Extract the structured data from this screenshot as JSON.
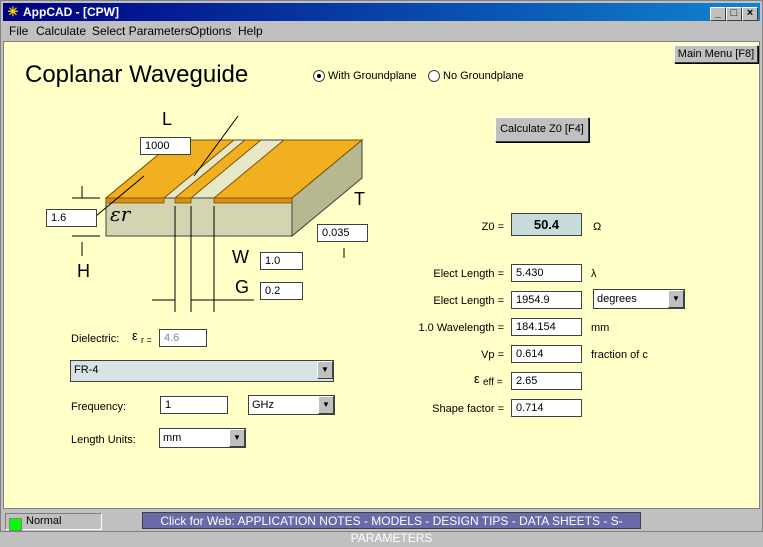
{
  "window": {
    "title": "AppCAD - [CPW]",
    "minimize": "_",
    "maximize": "□",
    "close": "×"
  },
  "menu": [
    {
      "label": "File"
    },
    {
      "label": "Calculate"
    },
    {
      "label": "Select Parameters"
    },
    {
      "label": "Options"
    },
    {
      "label": "Help"
    }
  ],
  "main_menu_button": "Main Menu [F8]",
  "page_title": "Coplanar Waveguide",
  "groundplane": {
    "with_label": "With Groundplane",
    "without_label": "No Groundplane",
    "selected": "with"
  },
  "calc_button": "Calculate Z0  [F4]",
  "diagram": {
    "L_label": "L",
    "L_value": "1000",
    "H_label": "H",
    "H_value": "1.6",
    "T_label": "T",
    "T_value": "0.035",
    "W_label": "W",
    "W_value": "1.0",
    "G_label": "G",
    "G_value": "0.2",
    "er_label": "εr"
  },
  "dielectric": {
    "label": "Dielectric:",
    "er_symbol": "ε",
    "er_suffix": "r =",
    "er_value": "4.6",
    "material": "FR-4"
  },
  "frequency": {
    "label": "Frequency:",
    "value": "1",
    "unit": "GHz"
  },
  "length_units": {
    "label": "Length Units:",
    "value": "mm"
  },
  "results": {
    "z0_label": "Z0 =",
    "z0_value": "50.4",
    "z0_unit": "Ω",
    "elect1_label": "Elect Length =",
    "elect1_value": "5.430",
    "elect1_unit": "λ",
    "elect2_label": "Elect Length =",
    "elect2_value": "1954.9",
    "elect2_unit": "degrees",
    "wave_label": "1.0 Wavelength =",
    "wave_value": "184.154",
    "wave_unit": "mm",
    "vp_label": "Vp =",
    "vp_value": "0.614",
    "vp_unit": "fraction of c",
    "eeff_symbol": "ε",
    "eeff_suffix": "eff =",
    "eeff_value": "2.65",
    "shape_label": "Shape factor =",
    "shape_value": "0.714"
  },
  "status": {
    "mode": "Normal",
    "web_link": "Click for Web: APPLICATION NOTES - MODELS - DESIGN TIPS - DATA SHEETS - S-PARAMETERS"
  },
  "colors": {
    "client_bg": "#ffffc8",
    "metal": "#f0b020",
    "substrate": "#d8d8b8",
    "title_blue": "#000080"
  }
}
